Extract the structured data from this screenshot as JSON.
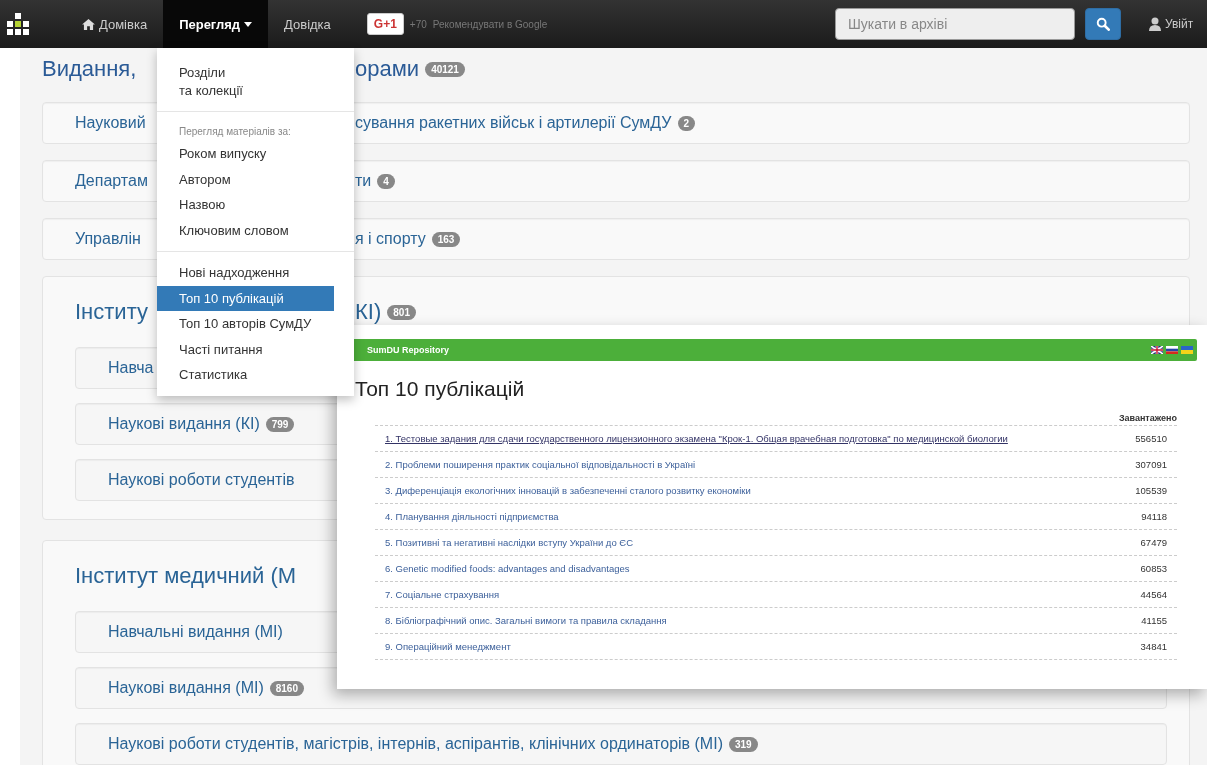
{
  "navbar": {
    "items": [
      {
        "label": "Домівка",
        "kind": "home",
        "selected": false
      },
      {
        "label": "Перегляд",
        "kind": "dropdown",
        "selected": true
      },
      {
        "label": "Довідка",
        "kind": "plain",
        "selected": false
      }
    ],
    "gplus": {
      "button": "G+1",
      "count": "+70",
      "text": "Рекомендувати в Google"
    },
    "search": {
      "placeholder": "Шукати в архіві"
    },
    "login": "Увійт"
  },
  "collections": [
    {
      "kind": "heading",
      "left": "Видання,",
      "right": "орами",
      "count": "40121"
    },
    {
      "kind": "card",
      "left": "Науковий",
      "right": "сування ракетних військ і артилерії СумДУ",
      "count": "2"
    },
    {
      "kind": "card",
      "left": "Департам",
      "right": "ти",
      "count": "4"
    },
    {
      "kind": "card",
      "left": "Управлін",
      "right": "я і спорту",
      "count": "163"
    },
    {
      "kind": "section",
      "left": "Інститу",
      "right": "КІ)",
      "count": "801",
      "children": [
        {
          "left": "Навча"
        },
        {
          "left": "Наукові видання (КІ)",
          "count": "799"
        },
        {
          "left": "Наукові роботи студентів"
        }
      ]
    },
    {
      "kind": "section",
      "left": "Інститут медичний (М",
      "children": [
        {
          "left": "Навчальні видання (МІ)"
        },
        {
          "left": "Наукові видання (МІ)",
          "count": "8160"
        },
        {
          "left": "Наукові роботи студентів, магістрів, інтернів, аспірантів, клінічних ординаторів (МІ)",
          "count": "319"
        }
      ]
    }
  ],
  "dropdown": {
    "items": [
      {
        "kind": "item",
        "label": "Розділи\nта колекції",
        "selected": false
      },
      {
        "kind": "divider"
      },
      {
        "kind": "header",
        "label": "Перегляд матеріалів за:"
      },
      {
        "kind": "item",
        "label": "Роком випуску",
        "selected": false
      },
      {
        "kind": "item",
        "label": "Автором",
        "selected": false
      },
      {
        "kind": "item",
        "label": "Назвою",
        "selected": false
      },
      {
        "kind": "item",
        "label": "Ключовим словом",
        "selected": false
      },
      {
        "kind": "divider"
      },
      {
        "kind": "item",
        "label": "Нові надходження",
        "selected": false
      },
      {
        "kind": "item",
        "label": "Топ 10 публікацій",
        "selected": true
      },
      {
        "kind": "item",
        "label": "Топ 10 авторів СумДУ",
        "selected": false
      },
      {
        "kind": "item",
        "label": "Часті питання",
        "selected": false
      },
      {
        "kind": "item",
        "label": "Статистика",
        "selected": false
      }
    ]
  },
  "popup": {
    "brand": "SumDU Repository",
    "title": "Топ 10 публікацій",
    "column": "Завантажено",
    "rows": [
      {
        "title": "1. Тестовые задания для сдачи государственного лицензионного экзамена \"Крок-1. Общая врачебная подготовка\" по медицинской биологии",
        "downloads": "556510",
        "visited": true
      },
      {
        "title": "2. Проблеми поширення практик соціальної відповідальності в Україні",
        "downloads": "307091",
        "visited": false
      },
      {
        "title": "3. Диференціація екологічних інновацій в забезпеченні сталого розвитку економіки",
        "downloads": "105539",
        "visited": false
      },
      {
        "title": "4. Планування діяльності підприємства",
        "downloads": "94118",
        "visited": false
      },
      {
        "title": "5. Позитивні та негативні наслідки вступу України до ЄС",
        "downloads": "67479",
        "visited": false
      },
      {
        "title": "6. Genetic modified foods: advantages and disadvantages",
        "downloads": "60853",
        "visited": false
      },
      {
        "title": "7. Соціальне страхування",
        "downloads": "44564",
        "visited": false
      },
      {
        "title": "8. Бібліографічний опис. Загальні вимоги та правила складання",
        "downloads": "41155",
        "visited": false
      },
      {
        "title": "9. Операційний менеджмент",
        "downloads": "34841",
        "visited": false
      }
    ]
  }
}
